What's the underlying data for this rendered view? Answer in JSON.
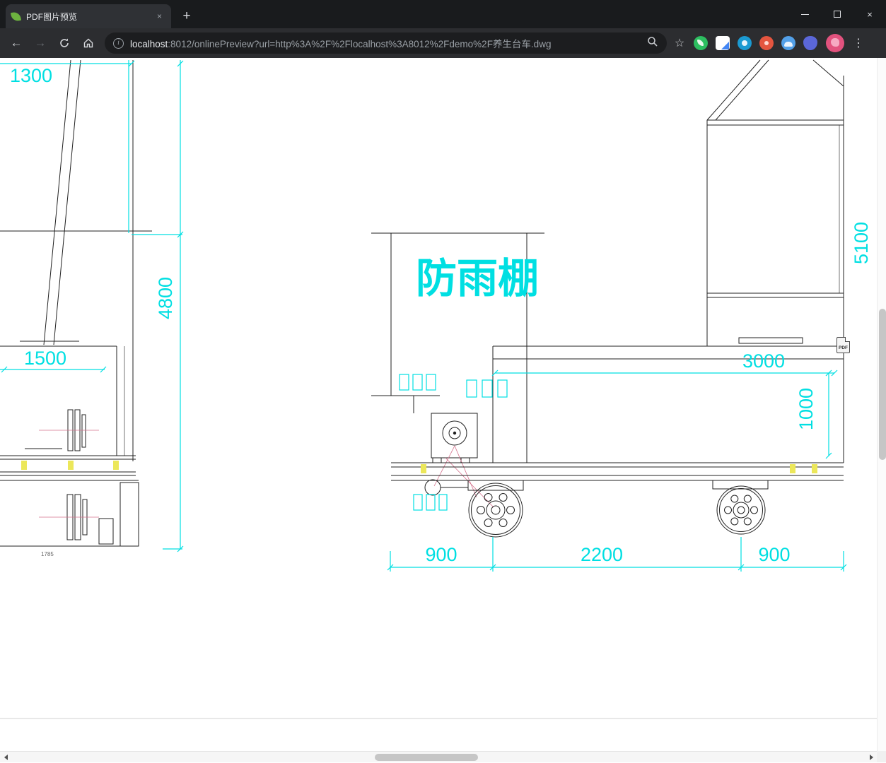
{
  "browser": {
    "tab": {
      "title": "PDF图片预览",
      "close_glyph": "×"
    },
    "new_tab_glyph": "+",
    "window": {
      "close_glyph": "×"
    },
    "nav": {
      "back_glyph": "←",
      "forward_glyph": "→"
    },
    "address": {
      "host": "localhost",
      "path": ":8012/onlinePreview?url=http%3A%2F%2Flocalhost%3A8012%2Fdemo%2F养生台车.dwg",
      "info_glyph": "i",
      "star_glyph": "☆"
    },
    "menu_glyph": "⋮"
  },
  "content": {
    "shelter_label": "防雨棚",
    "pdf_icon_label": "PDF",
    "dims": {
      "top_left_width": "1300",
      "left_height": "4800",
      "left_width": "1500",
      "right_height": "5100",
      "frame_width": "3000",
      "frame_height": "1000",
      "wheel_left": "900",
      "wheel_span": "2200",
      "wheel_right": "900",
      "small_note": "1785"
    },
    "colors": {
      "dimension_cyan": "#00dfe2",
      "drawing_line": "#202020",
      "centerline_pink": "#d4718c",
      "tick_yellow": "#ece75a"
    }
  }
}
